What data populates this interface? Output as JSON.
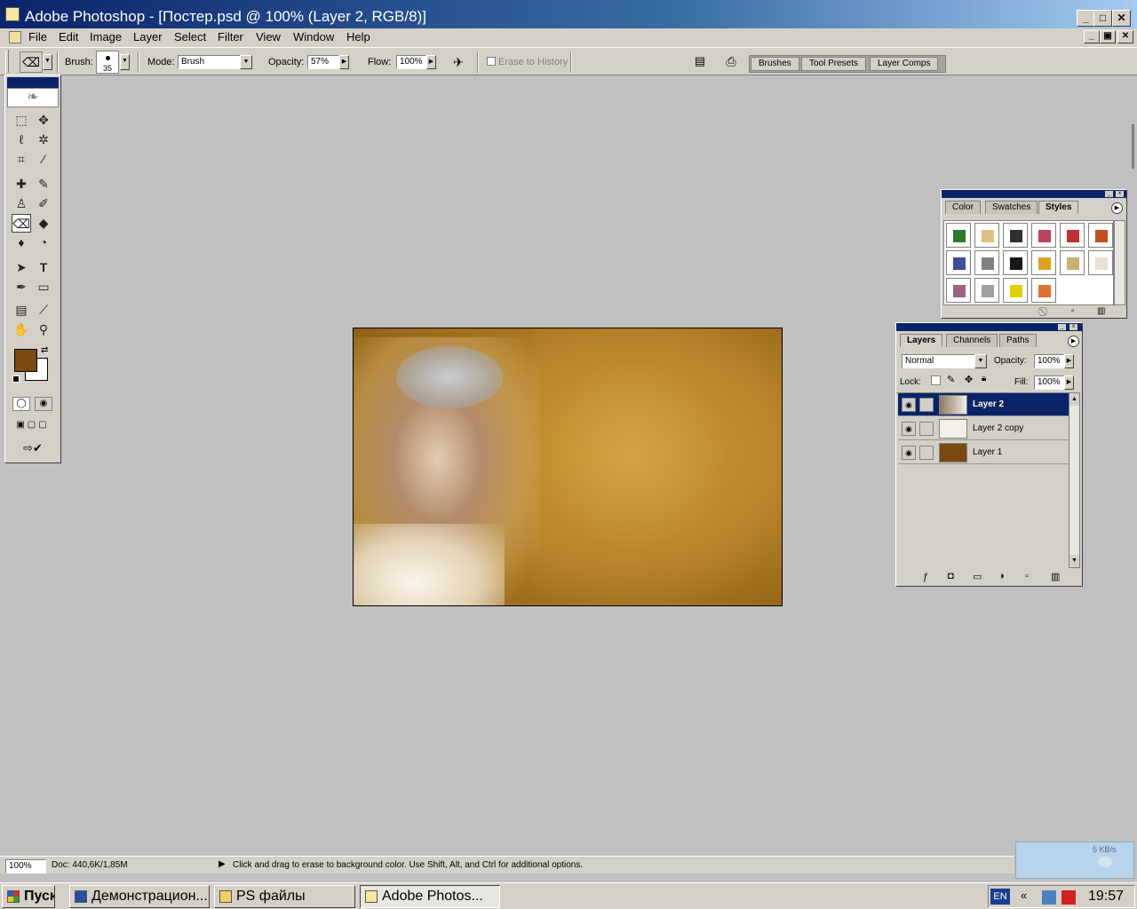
{
  "window": {
    "title": "Adobe Photoshop - [Постер.psd @ 100% (Layer 2, RGB/8)]",
    "caption_buttons": [
      "_",
      "□",
      "✕"
    ],
    "doc_buttons": [
      "_",
      "▣",
      "✕"
    ]
  },
  "menu": [
    "File",
    "Edit",
    "Image",
    "Layer",
    "Select",
    "Filter",
    "View",
    "Window",
    "Help"
  ],
  "options": {
    "brush_label": "Brush:",
    "brush_size": "35",
    "mode_label": "Mode:",
    "mode_value": "Brush",
    "opacity_label": "Opacity:",
    "opacity_value": "57%",
    "flow_label": "Flow:",
    "flow_value": "100%",
    "erase_history_label": "Erase to History",
    "well_tabs": [
      "Brushes",
      "Tool Presets",
      "Layer Comps"
    ]
  },
  "styles_panel": {
    "tabs": [
      "Color",
      "Swatches",
      "Styles"
    ],
    "swatches": [
      [
        "#2a7a30",
        "#e0c080",
        "#303030",
        "#c04060",
        "#c03030",
        "#c05020"
      ],
      [
        "#404c9c",
        "#808080",
        "#181818",
        "#e0a020",
        "#c8b070",
        "#e8e0d0"
      ],
      [
        "#a06080",
        "#a0a0a0",
        "#e0d000",
        "#e07030"
      ]
    ]
  },
  "layers_panel": {
    "tabs": [
      "Layers",
      "Channels",
      "Paths"
    ],
    "blend_mode": "Normal",
    "opacity_label": "Opacity:",
    "opacity_value": "100%",
    "lock_label": "Lock:",
    "fill_label": "Fill:",
    "fill_value": "100%",
    "layers": [
      {
        "name": "Layer 2",
        "selected": true
      },
      {
        "name": "Layer 2 copy",
        "selected": false
      },
      {
        "name": "Layer 1",
        "selected": false
      }
    ]
  },
  "status": {
    "zoom": "100%",
    "doc_info": "Doc: 440,6K/1,85M",
    "hint": "Click and drag to erase to background color.  Use Shift, Alt, and Ctrl for additional options."
  },
  "colors": {
    "foreground": "#7a4a10",
    "background": "#ffffff"
  },
  "taskbar": {
    "start_label": "Пуск",
    "buttons": [
      "Демонстрацион...",
      "PS файлы",
      "Adobe Photos..."
    ],
    "lang": "EN",
    "net_speed": "5 KB/s",
    "clock": "19:57"
  }
}
